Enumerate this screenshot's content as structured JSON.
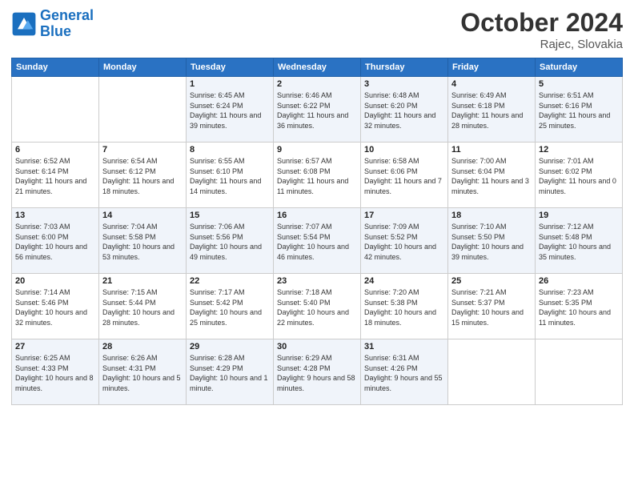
{
  "header": {
    "logo_line1": "General",
    "logo_line2": "Blue",
    "month": "October 2024",
    "location": "Rajec, Slovakia"
  },
  "weekdays": [
    "Sunday",
    "Monday",
    "Tuesday",
    "Wednesday",
    "Thursday",
    "Friday",
    "Saturday"
  ],
  "weeks": [
    [
      {
        "day": "",
        "info": ""
      },
      {
        "day": "",
        "info": ""
      },
      {
        "day": "1",
        "info": "Sunrise: 6:45 AM\nSunset: 6:24 PM\nDaylight: 11 hours and 39 minutes."
      },
      {
        "day": "2",
        "info": "Sunrise: 6:46 AM\nSunset: 6:22 PM\nDaylight: 11 hours and 36 minutes."
      },
      {
        "day": "3",
        "info": "Sunrise: 6:48 AM\nSunset: 6:20 PM\nDaylight: 11 hours and 32 minutes."
      },
      {
        "day": "4",
        "info": "Sunrise: 6:49 AM\nSunset: 6:18 PM\nDaylight: 11 hours and 28 minutes."
      },
      {
        "day": "5",
        "info": "Sunrise: 6:51 AM\nSunset: 6:16 PM\nDaylight: 11 hours and 25 minutes."
      }
    ],
    [
      {
        "day": "6",
        "info": "Sunrise: 6:52 AM\nSunset: 6:14 PM\nDaylight: 11 hours and 21 minutes."
      },
      {
        "day": "7",
        "info": "Sunrise: 6:54 AM\nSunset: 6:12 PM\nDaylight: 11 hours and 18 minutes."
      },
      {
        "day": "8",
        "info": "Sunrise: 6:55 AM\nSunset: 6:10 PM\nDaylight: 11 hours and 14 minutes."
      },
      {
        "day": "9",
        "info": "Sunrise: 6:57 AM\nSunset: 6:08 PM\nDaylight: 11 hours and 11 minutes."
      },
      {
        "day": "10",
        "info": "Sunrise: 6:58 AM\nSunset: 6:06 PM\nDaylight: 11 hours and 7 minutes."
      },
      {
        "day": "11",
        "info": "Sunrise: 7:00 AM\nSunset: 6:04 PM\nDaylight: 11 hours and 3 minutes."
      },
      {
        "day": "12",
        "info": "Sunrise: 7:01 AM\nSunset: 6:02 PM\nDaylight: 11 hours and 0 minutes."
      }
    ],
    [
      {
        "day": "13",
        "info": "Sunrise: 7:03 AM\nSunset: 6:00 PM\nDaylight: 10 hours and 56 minutes."
      },
      {
        "day": "14",
        "info": "Sunrise: 7:04 AM\nSunset: 5:58 PM\nDaylight: 10 hours and 53 minutes."
      },
      {
        "day": "15",
        "info": "Sunrise: 7:06 AM\nSunset: 5:56 PM\nDaylight: 10 hours and 49 minutes."
      },
      {
        "day": "16",
        "info": "Sunrise: 7:07 AM\nSunset: 5:54 PM\nDaylight: 10 hours and 46 minutes."
      },
      {
        "day": "17",
        "info": "Sunrise: 7:09 AM\nSunset: 5:52 PM\nDaylight: 10 hours and 42 minutes."
      },
      {
        "day": "18",
        "info": "Sunrise: 7:10 AM\nSunset: 5:50 PM\nDaylight: 10 hours and 39 minutes."
      },
      {
        "day": "19",
        "info": "Sunrise: 7:12 AM\nSunset: 5:48 PM\nDaylight: 10 hours and 35 minutes."
      }
    ],
    [
      {
        "day": "20",
        "info": "Sunrise: 7:14 AM\nSunset: 5:46 PM\nDaylight: 10 hours and 32 minutes."
      },
      {
        "day": "21",
        "info": "Sunrise: 7:15 AM\nSunset: 5:44 PM\nDaylight: 10 hours and 28 minutes."
      },
      {
        "day": "22",
        "info": "Sunrise: 7:17 AM\nSunset: 5:42 PM\nDaylight: 10 hours and 25 minutes."
      },
      {
        "day": "23",
        "info": "Sunrise: 7:18 AM\nSunset: 5:40 PM\nDaylight: 10 hours and 22 minutes."
      },
      {
        "day": "24",
        "info": "Sunrise: 7:20 AM\nSunset: 5:38 PM\nDaylight: 10 hours and 18 minutes."
      },
      {
        "day": "25",
        "info": "Sunrise: 7:21 AM\nSunset: 5:37 PM\nDaylight: 10 hours and 15 minutes."
      },
      {
        "day": "26",
        "info": "Sunrise: 7:23 AM\nSunset: 5:35 PM\nDaylight: 10 hours and 11 minutes."
      }
    ],
    [
      {
        "day": "27",
        "info": "Sunrise: 6:25 AM\nSunset: 4:33 PM\nDaylight: 10 hours and 8 minutes."
      },
      {
        "day": "28",
        "info": "Sunrise: 6:26 AM\nSunset: 4:31 PM\nDaylight: 10 hours and 5 minutes."
      },
      {
        "day": "29",
        "info": "Sunrise: 6:28 AM\nSunset: 4:29 PM\nDaylight: 10 hours and 1 minute."
      },
      {
        "day": "30",
        "info": "Sunrise: 6:29 AM\nSunset: 4:28 PM\nDaylight: 9 hours and 58 minutes."
      },
      {
        "day": "31",
        "info": "Sunrise: 6:31 AM\nSunset: 4:26 PM\nDaylight: 9 hours and 55 minutes."
      },
      {
        "day": "",
        "info": ""
      },
      {
        "day": "",
        "info": ""
      }
    ]
  ]
}
